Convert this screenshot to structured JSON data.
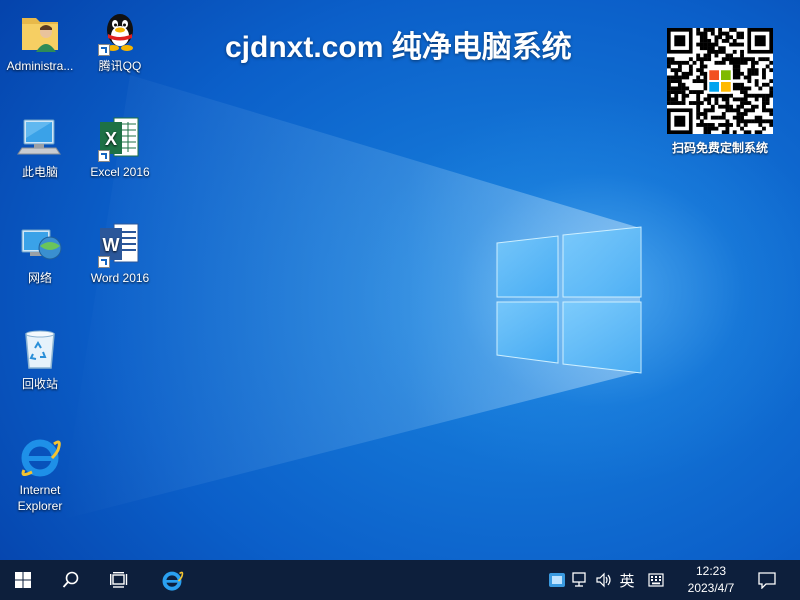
{
  "banner": {
    "title": "cjdnxt.com 纯净电脑系统",
    "qr_caption": "扫码免费定制系统"
  },
  "desktop_icons": [
    {
      "label": "Administra...",
      "icon": "user-folder-icon"
    },
    {
      "label": "腾讯QQ",
      "icon": "qq-penguin-icon",
      "shortcut": true
    },
    {
      "label": "此电脑",
      "icon": "this-pc-icon"
    },
    {
      "label": "Excel 2016",
      "icon": "excel-icon",
      "shortcut": true
    },
    {
      "label": "网络",
      "icon": "network-icon"
    },
    {
      "label": "Word 2016",
      "icon": "word-icon",
      "shortcut": true
    },
    {
      "label": "回收站",
      "icon": "recycle-bin-icon"
    },
    {
      "label": "Internet Explorer",
      "icon": "internet-explorer-icon"
    }
  ],
  "taskbar": {
    "start_icon": "windows-start-icon",
    "search_icon": "search-icon",
    "task_view_icon": "task-view-icon",
    "pinned": [
      {
        "icon": "internet-explorer-icon",
        "active": true
      }
    ],
    "tray": {
      "ime_lang": "英",
      "time": "12:23",
      "date": "2023/4/7"
    }
  },
  "colors": {
    "desktop_blue": "#0b5fc9",
    "taskbar": "#0d1f3c",
    "excel_green": "#1e7145",
    "word_blue": "#2b579a"
  }
}
